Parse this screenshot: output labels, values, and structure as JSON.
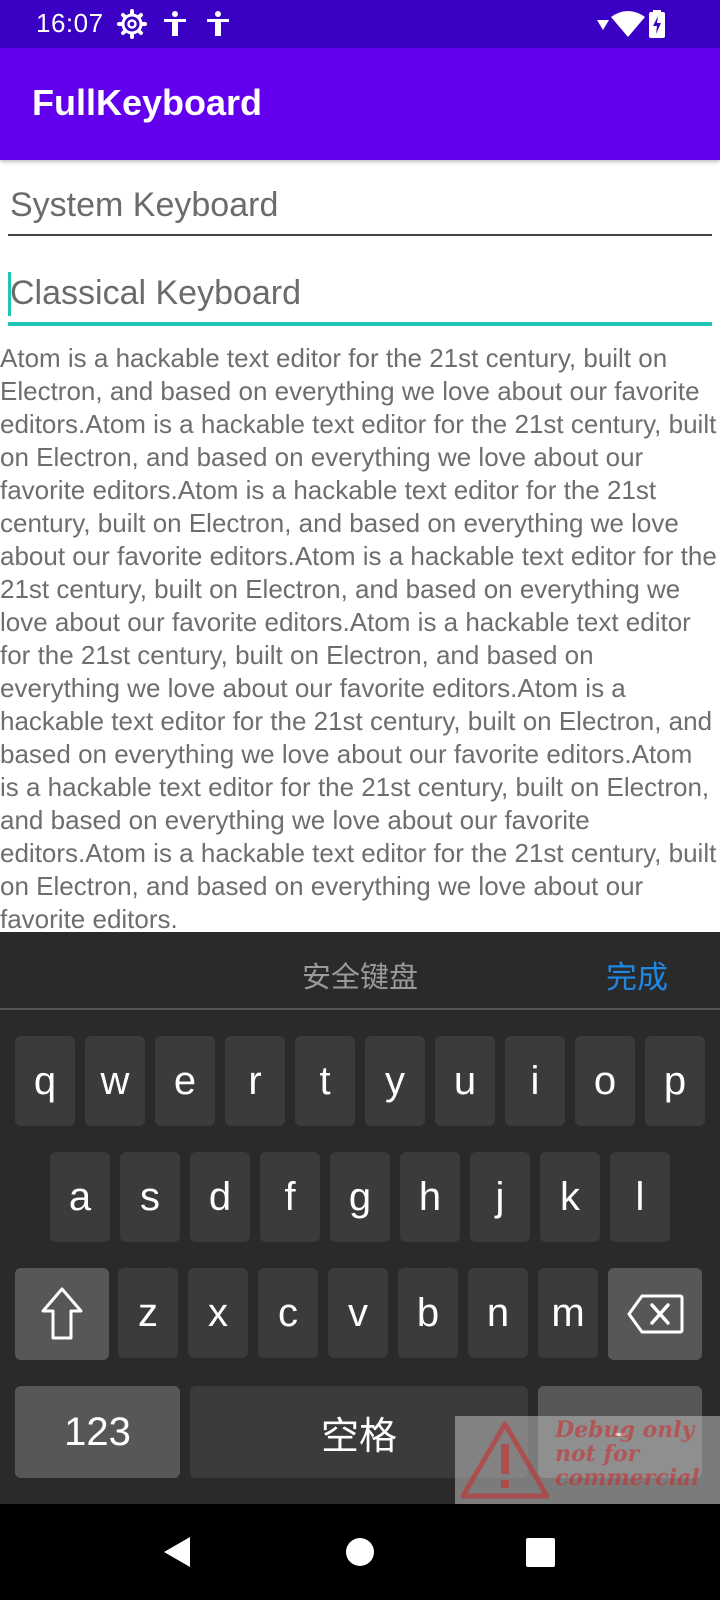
{
  "status_bar": {
    "time": "16:07",
    "icons": [
      "settings-gear-icon",
      "accessibility-icon",
      "accessibility-icon",
      "signal-icon",
      "wifi-icon",
      "battery-charging-icon"
    ]
  },
  "app_bar": {
    "title": "FullKeyboard"
  },
  "inputs": {
    "system_hint": "System Keyboard",
    "classical_hint": "Classical Keyboard"
  },
  "body_text": "Atom is a hackable text editor for the 21st century, built on Electron, and based on everything we love about our favorite editors.Atom is a hackable text editor for the 21st century, built on Electron, and based on everything we love about our favorite editors.Atom is a hackable text editor for the 21st century, built on Electron, and based on everything we love about our favorite editors.Atom is a hackable text editor for the 21st century, built on Electron, and based on everything we love about our favorite editors.Atom is a hackable text editor for the 21st century, built on Electron, and based on everything we love about our favorite editors.Atom is a hackable text editor for the 21st century, built on Electron, and based on everything we love about our favorite editors.Atom is a hackable text editor for the 21st century, built on Electron, and based on everything we love about our favorite editors.Atom is a hackable text editor for the 21st century, built on Electron, and based on everything we love about our favorite editors.",
  "keyboard": {
    "title": "安全键盘",
    "done": "完成",
    "row1": [
      "q",
      "w",
      "e",
      "r",
      "t",
      "y",
      "u",
      "i",
      "o",
      "p"
    ],
    "row2": [
      "a",
      "s",
      "d",
      "f",
      "g",
      "h",
      "j",
      "k",
      "l"
    ],
    "row3": [
      "z",
      "x",
      "c",
      "v",
      "b",
      "n",
      "m"
    ],
    "shift_icon": "shift-arrow-icon",
    "backspace_icon": "backspace-icon",
    "numbers": "123",
    "space": "空格",
    "symbol": "-"
  },
  "watermark": {
    "line1": "Debug  only",
    "line2": "not for",
    "line3": "commercial"
  },
  "nav_bar": {
    "icons": [
      "back-triangle-icon",
      "home-circle-icon",
      "recents-square-icon"
    ]
  },
  "colors": {
    "status_bar": "#3a00c4",
    "app_bar": "#6200ee",
    "accent": "#1fc6b6",
    "keyboard_bg": "#2a2a2a",
    "done_blue": "#1e88e5"
  }
}
